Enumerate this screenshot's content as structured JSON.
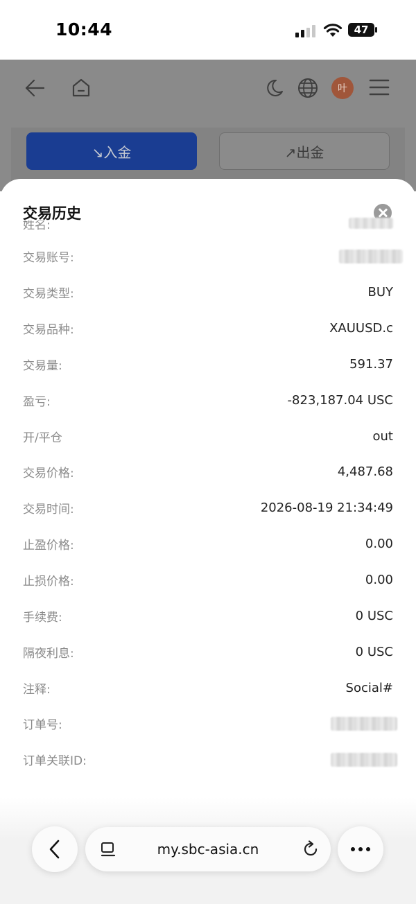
{
  "status_bar": {
    "time": "10:44",
    "battery": "47"
  },
  "nav": {
    "avatar_text": "叶"
  },
  "actions": {
    "deposit": "↘入金",
    "withdraw": "↗出金"
  },
  "modal": {
    "title": "交易历史",
    "clipped_label": "姓名:",
    "rows": [
      {
        "label": "交易账号:",
        "value": ""
      },
      {
        "label": "交易类型:",
        "value": "BUY"
      },
      {
        "label": "交易品种:",
        "value": "XAUUSD.c"
      },
      {
        "label": "交易量:",
        "value": "591.37"
      },
      {
        "label": "盈亏:",
        "value": "-823,187.04 USC"
      },
      {
        "label": "开/平仓",
        "value": "out"
      },
      {
        "label": "交易价格:",
        "value": "4,487.68"
      },
      {
        "label": "交易时间:",
        "value": "2026-08-19 21:34:49"
      },
      {
        "label": "止盈价格:",
        "value": "0.00"
      },
      {
        "label": "止损价格:",
        "value": "0.00"
      },
      {
        "label": "手续费:",
        "value": "0 USC"
      },
      {
        "label": "隔夜利息:",
        "value": "0 USC"
      },
      {
        "label": "注释:",
        "value": "Social#"
      },
      {
        "label": "订单号:",
        "value": ""
      },
      {
        "label": "订单关联ID:",
        "value": ""
      }
    ]
  },
  "browser": {
    "url": "my.sbc-asia.cn"
  },
  "colors": {
    "accent_blue": "#1a3d92",
    "avatar_bg": "#a0563a"
  }
}
